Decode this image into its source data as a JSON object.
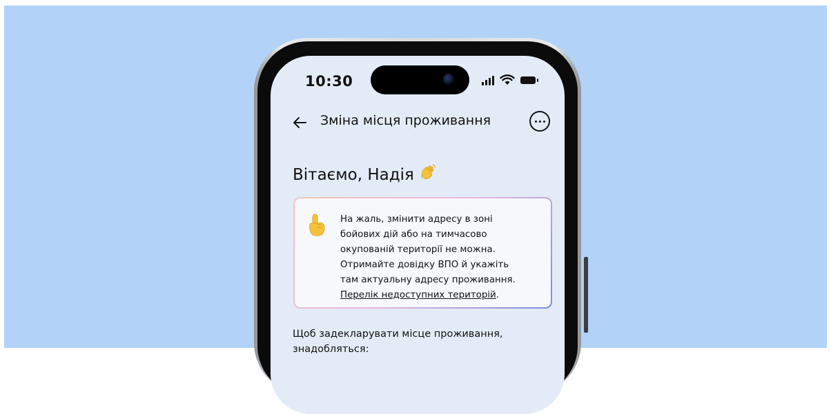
{
  "status_bar": {
    "time": "10:30"
  },
  "header": {
    "title": "Зміна місця проживання",
    "back_icon": "arrow-left-icon",
    "more_icon": "more-horizontal-icon"
  },
  "greeting": {
    "text": "Вітаємо, Надія",
    "emoji_icon": "waving-hand-icon"
  },
  "alert": {
    "icon": "pointing-up-hand-icon",
    "lines": [
      "На жаль, змінити адресу в зоні",
      "бойових дій або на тимчасово",
      "окупованій території не можна.",
      "Отримайте довідку ВПО й укажіть",
      "там актуальну адресу проживання."
    ],
    "link_text": "Перелік недоступних територій",
    "link_suffix": "."
  },
  "body": {
    "intro_lines": [
      "Щоб задекларувати місце проживання,",
      "знадобляться:"
    ]
  },
  "colors": {
    "background": "#b2d2f7",
    "screen": "#e3ecf6",
    "alert_gradient": [
      "#f7c7b4",
      "#e9b7df",
      "#7b8bdf"
    ]
  }
}
